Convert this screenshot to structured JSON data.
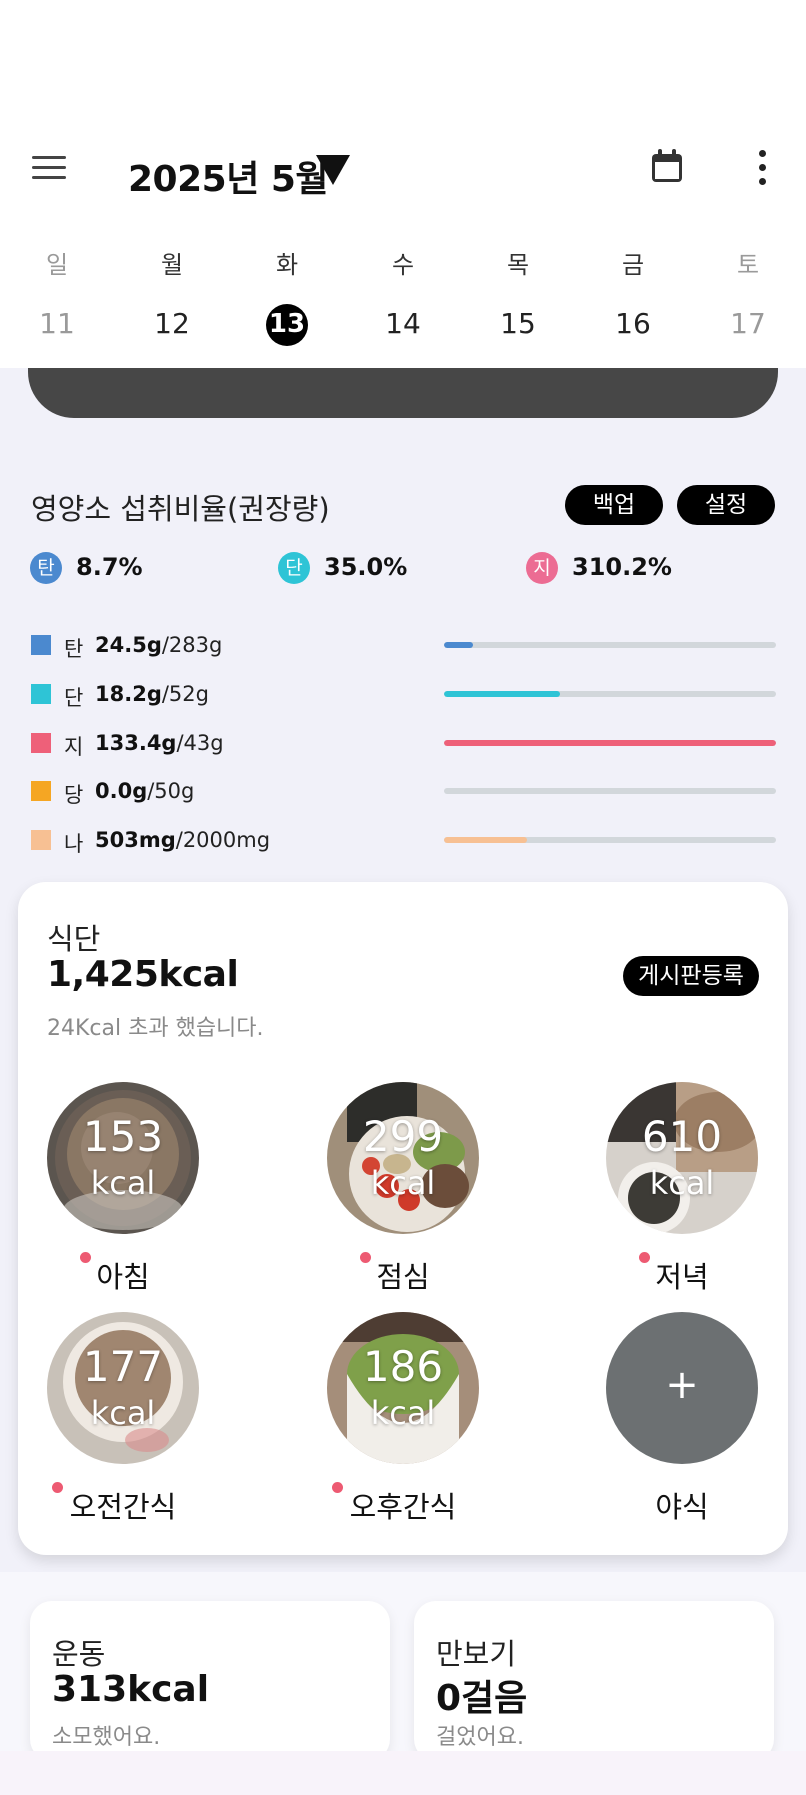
{
  "header": {
    "month_label": "2025년 5월",
    "icons": {
      "menu": "hamburger-menu-icon",
      "dropdown": "triangle-down-icon",
      "calendar": "calendar-icon",
      "more": "more-vertical-icon"
    },
    "week": [
      {
        "weekday": "일",
        "date": "11",
        "dim": true
      },
      {
        "weekday": "월",
        "date": "12",
        "dim": false
      },
      {
        "weekday": "화",
        "date": "13",
        "selected": true
      },
      {
        "weekday": "수",
        "date": "14",
        "dim": false
      },
      {
        "weekday": "목",
        "date": "15",
        "dim": false
      },
      {
        "weekday": "금",
        "date": "16",
        "dim": false
      },
      {
        "weekday": "토",
        "date": "17",
        "dim": true
      }
    ]
  },
  "nutrition": {
    "title": "영양소 섭취비율(권장량)",
    "backup_label": "백업",
    "settings_label": "설정",
    "ratios": [
      {
        "badge": "탄",
        "value": "8.7%",
        "color": "#4b89cf"
      },
      {
        "badge": "단",
        "value": "35.0%",
        "color": "#2ec4d6"
      },
      {
        "badge": "지",
        "value": "310.2%",
        "color": "#ec6c93"
      }
    ],
    "rows": [
      {
        "label": "탄",
        "amount": "24.5g",
        "goal": "/283g",
        "color": "#4b89cf",
        "progress": 0.087
      },
      {
        "label": "단",
        "amount": "18.2g",
        "goal": "/52g",
        "color": "#2ec4d6",
        "progress": 0.35
      },
      {
        "label": "지",
        "amount": "133.4g",
        "goal": "/43g",
        "color": "#ee6079",
        "progress": 1.0
      },
      {
        "label": "당",
        "amount": "0.0g",
        "goal": "/50g",
        "color": "#f5a623",
        "progress": 0.0
      },
      {
        "label": "나",
        "amount": "503mg",
        "goal": "/2000mg",
        "color": "#f7c093",
        "progress": 0.25
      }
    ]
  },
  "meals": {
    "title": "식단",
    "total": "1,425kcal",
    "note": "24Kcal 초과 했습니다.",
    "board_label": "게시판등록",
    "kcal_unit": "kcal",
    "items": [
      {
        "name": "아침",
        "kcal": "153"
      },
      {
        "name": "점심",
        "kcal": "299"
      },
      {
        "name": "저녁",
        "kcal": "610"
      },
      {
        "name": "오전간식",
        "kcal": "177"
      },
      {
        "name": "오후간식",
        "kcal": "186"
      },
      {
        "name": "야식",
        "plus": "+"
      }
    ]
  },
  "exercise": {
    "title": "운동",
    "value": "313kcal",
    "sub": "소모했어요."
  },
  "pedometer": {
    "title": "만보기",
    "value": "0걸음",
    "sub": "걸었어요."
  }
}
